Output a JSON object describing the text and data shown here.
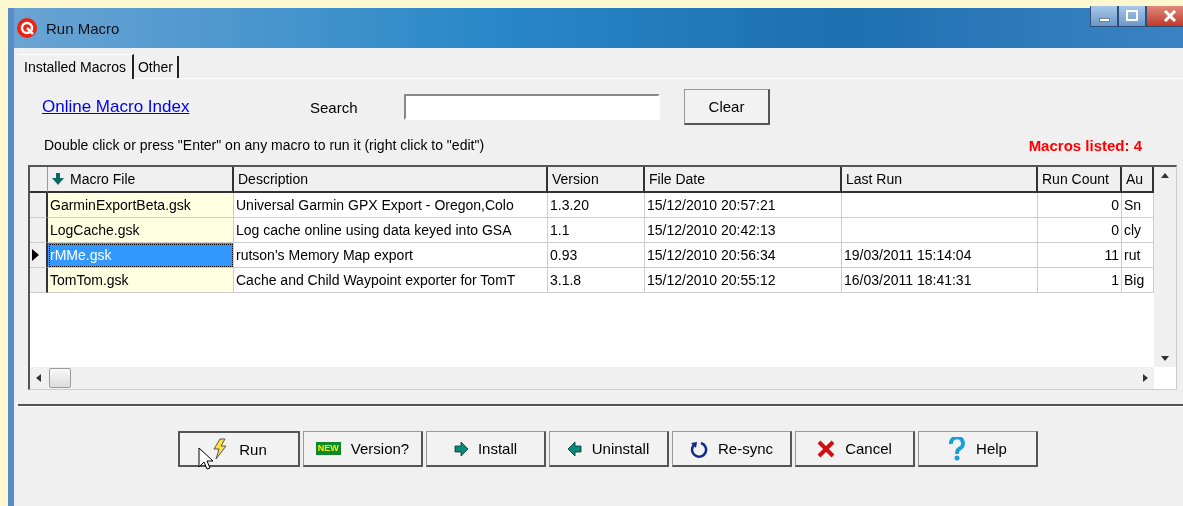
{
  "window": {
    "title": "Run Macro"
  },
  "tabs": [
    {
      "label": "Installed Macros",
      "selected": true
    },
    {
      "label": "Other",
      "selected": false
    }
  ],
  "link": "Online Macro Index",
  "search": {
    "label": "Search"
  },
  "clear_button": "Clear",
  "hint": "Double click or press \"Enter\" on any macro to run it (right click to \"edit\")",
  "count": "Macros listed: 4",
  "table": {
    "columns": [
      "Macro File",
      "Description",
      "Version",
      "File Date",
      "Last Run",
      "Run Count",
      "Au"
    ],
    "rows": [
      {
        "cells": [
          "GarminExportBeta.gsk",
          "Universal Garmin GPX Export  - Oregon,Colo",
          "1.3.20",
          "15/12/2010 20:57:21",
          "",
          "0",
          "Sn"
        ],
        "selected": false
      },
      {
        "cells": [
          "LogCache.gsk",
          "Log cache online using data keyed into GSA",
          "1.1",
          "15/12/2010 20:42:13",
          "",
          "0",
          "cly"
        ],
        "selected": false
      },
      {
        "cells": [
          "rMMe.gsk",
          "rutson's Memory Map export",
          "0.93",
          "15/12/2010 20:56:34",
          "19/03/2011 15:14:04",
          "11",
          "rut"
        ],
        "selected": true
      },
      {
        "cells": [
          "TomTom.gsk",
          "Cache and Child Waypoint exporter for TomT",
          "3.1.8",
          "15/12/2010 20:55:12",
          "16/03/2011 18:41:31",
          "1",
          "Big"
        ],
        "selected": false
      }
    ]
  },
  "buttons": [
    {
      "label": "Run",
      "kind": "lightning"
    },
    {
      "label": "Version?",
      "kind": "new",
      "badge": "NEW"
    },
    {
      "label": "Install",
      "kind": "right"
    },
    {
      "label": "Uninstall",
      "kind": "left"
    },
    {
      "label": "Re-sync",
      "kind": "sync"
    },
    {
      "label": "Cancel",
      "kind": "cancel"
    },
    {
      "label": "Help",
      "kind": "help"
    }
  ]
}
